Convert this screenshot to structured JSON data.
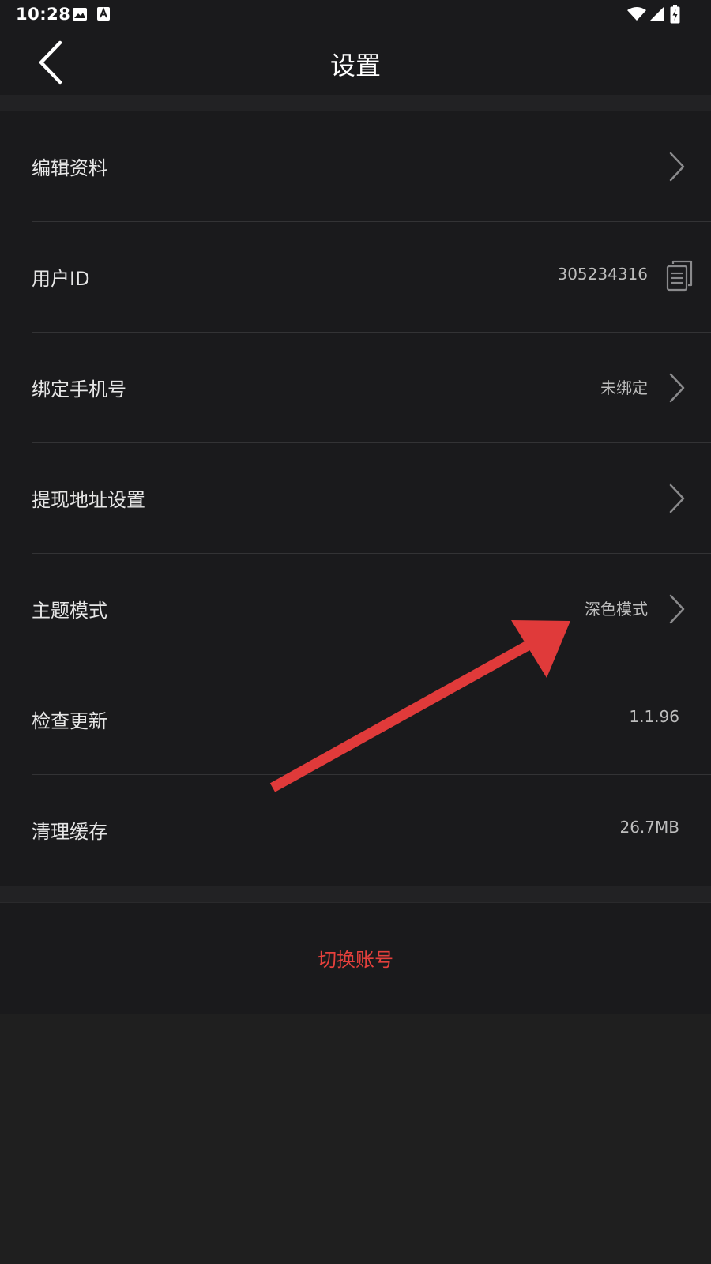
{
  "status_bar": {
    "time": "10:28",
    "icons": [
      "image-icon",
      "a-badge-icon",
      "wifi-icon",
      "signal-icon",
      "battery-charging-icon"
    ]
  },
  "header": {
    "title": "设置",
    "back_icon": "chevron-left-icon"
  },
  "settings": {
    "items": [
      {
        "label": "编辑资料",
        "value": "",
        "trailing": "chevron-right-icon"
      },
      {
        "label": "用户ID",
        "value": "305234316",
        "trailing": "copy-icon"
      },
      {
        "label": "绑定手机号",
        "value": "未绑定",
        "trailing": "chevron-right-icon"
      },
      {
        "label": "提现地址设置",
        "value": "",
        "trailing": "chevron-right-icon"
      },
      {
        "label": "主题模式",
        "value": "深色模式",
        "trailing": "chevron-right-icon"
      },
      {
        "label": "检查更新",
        "value": "1.1.96",
        "trailing": ""
      },
      {
        "label": "清理缓存",
        "value": "26.7MB",
        "trailing": ""
      }
    ]
  },
  "switch_account": {
    "label": "切换账号",
    "color": "#e5403c"
  },
  "colors": {
    "background": "#1f1f1f",
    "surface": "#1a1a1c",
    "accent_red": "#e5403c",
    "annotation_arrow": "#e03a3a"
  }
}
